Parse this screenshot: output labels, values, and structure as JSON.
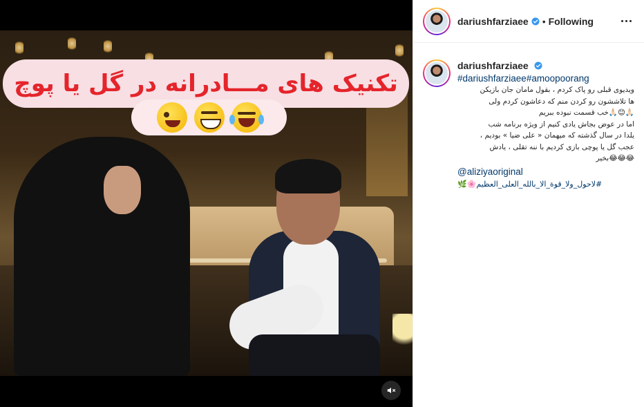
{
  "media": {
    "overlay_title": "تکنیک های مـــادرانه در گل یا پوچ",
    "emoji_row": [
      "stuck-out-tongue-winking-emoji",
      "grinning-squinting-emoji",
      "tears-of-joy-emoji"
    ],
    "mute_icon": "speaker-muted-icon"
  },
  "post": {
    "username": "dariushfarziaee",
    "separator": "•",
    "follow_status": "Following",
    "more_icon": "more-options-icon"
  },
  "caption": {
    "username": "dariushfarziaee",
    "hashtags": "#dariushfarziaee#amoopoorang",
    "lines": [
      "ویدیوی قبلی رو پاک کردم ، بقول مامان جان بازیکن",
      "ها تلاششون رو کردن منم که دعاشون کردم ولی",
      "🙏🏻😊🙏🏻خب قسمت نبوده ببریم",
      "اما در عوض بجاش یادی کنیم از ویژه برنامه شب",
      "یلدا در سال گذشته که میهمان « علی ضیا » بودیم ،",
      "عجب گل یا پوچی بازی کردیم با ننه تقلی ، یادش",
      "😂😂😂بخیر"
    ],
    "mention": "@aliziyaoriginal",
    "closing_hashtag": "#لاحول_ولا_قوة_الا_بالله_العلی_العظیم🌸🌿"
  },
  "colors": {
    "overlay_text": "#e5242b",
    "overlay_bg": "#f7dfe4",
    "link": "#00376b",
    "verified": "#3897f0"
  }
}
